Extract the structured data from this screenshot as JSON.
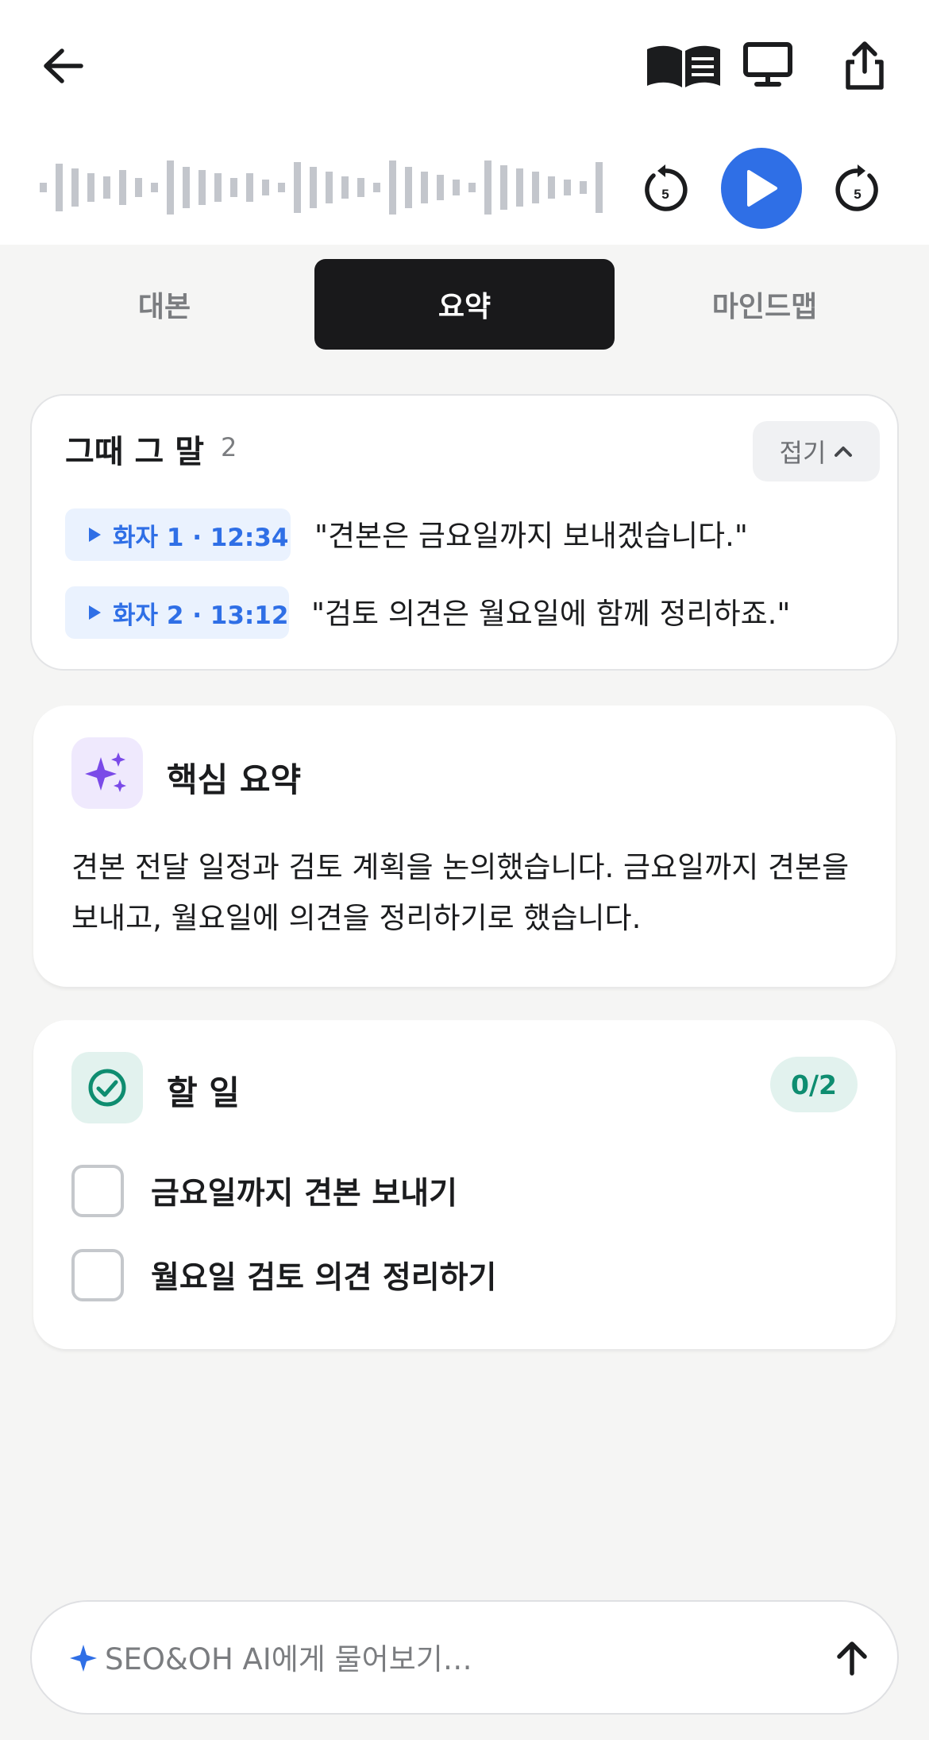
{
  "header": {
    "back_icon": "arrow-left-icon",
    "actions": [
      "book-icon",
      "monitor-icon",
      "share-icon"
    ]
  },
  "player": {
    "rewind_seconds": "5",
    "forward_seconds": "5",
    "accent_color": "#2f6fe6"
  },
  "tabs": [
    {
      "label": "대본",
      "active": false
    },
    {
      "label": "요약",
      "active": true
    },
    {
      "label": "마인드맵",
      "active": false
    }
  ],
  "quotes_card": {
    "title": "그때 그 말",
    "count": "2",
    "collapse_label": "접기",
    "items": [
      {
        "chip": "화자 1 · 12:34",
        "text": "\"견본은 금요일까지 보내겠습니다.\""
      },
      {
        "chip": "화자 2 · 13:12",
        "text": "\"검토 의견은 월요일에 함께 정리하죠.\""
      }
    ]
  },
  "summary_card": {
    "title": "핵심 요약",
    "icon": "sparkles-icon",
    "body": "견본 전달 일정과 검토 계획을 논의했습니다. 금요일까지 견본을 보내고, 월요일에 의견을 정리하기로 했습니다."
  },
  "todo_card": {
    "title": "할 일",
    "icon": "check-circle-icon",
    "progress": "0/2",
    "items": [
      {
        "label": "금요일까지 견본 보내기",
        "done": false
      },
      {
        "label": "월요일 검토 의견 정리하기",
        "done": false
      }
    ]
  },
  "ask": {
    "placeholder": "SEO&OH AI에게 물어보기…",
    "send_icon": "arrow-up-icon"
  }
}
